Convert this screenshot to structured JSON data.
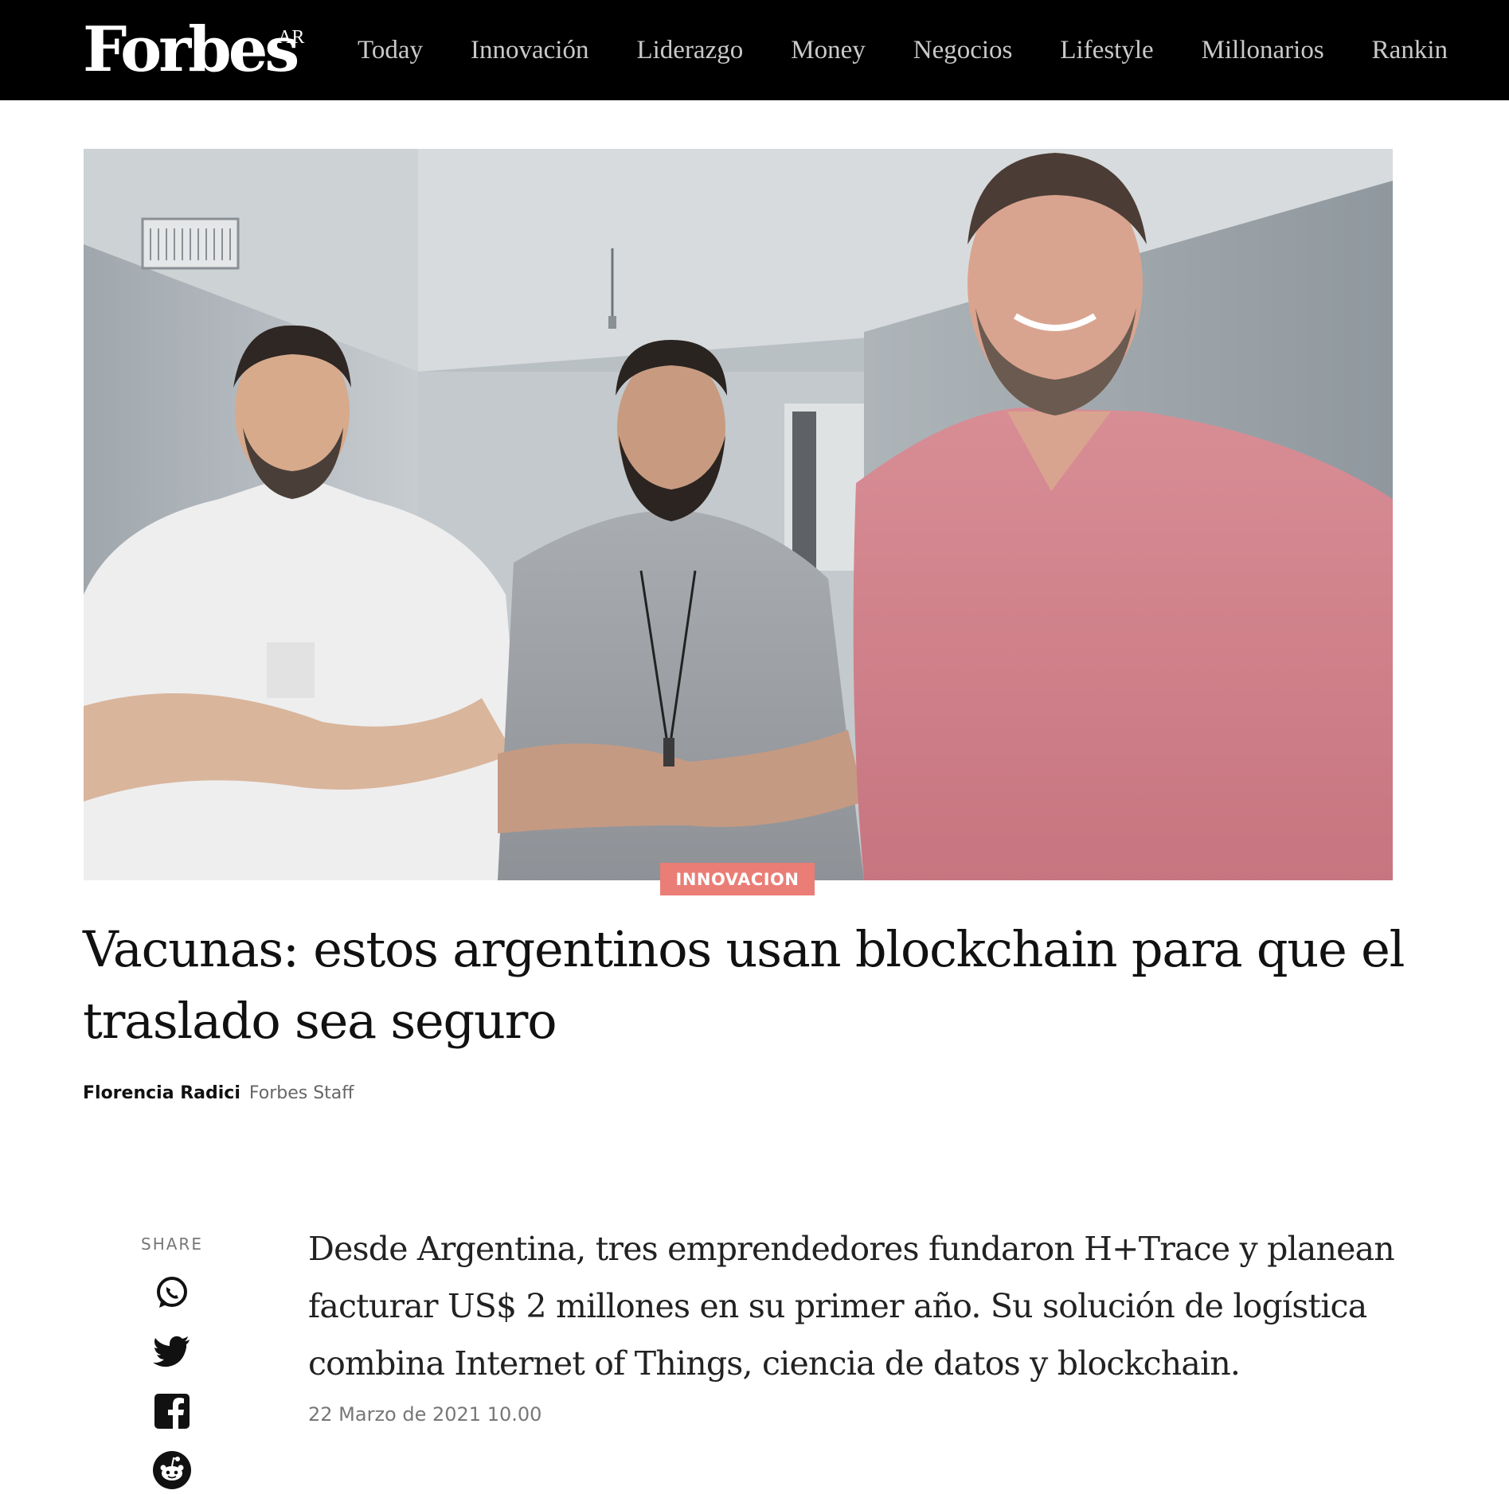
{
  "header": {
    "logo": "Forbes",
    "region": "AR",
    "nav": [
      "Today",
      "Innovación",
      "Liderazgo",
      "Money",
      "Negocios",
      "Lifestyle",
      "Millonarios",
      "Rankin"
    ]
  },
  "hero": {
    "image_icon": "photo-of-three-men-icon"
  },
  "article": {
    "category": "INNOVACION",
    "headline": "Vacunas: estos argentinos usan blockchain para que el traslado sea seguro",
    "author": "Florencia Radici",
    "author_role": "Forbes Staff",
    "summary": "Desde Argentina, tres emprendedores fundaron H+Trace y planean facturar US$ 2 millones en su primer año. Su solución de logística combina Internet of Things, ciencia de datos y blockchain.",
    "date": "22 Marzo de 2021 10.00"
  },
  "share": {
    "label": "SHARE",
    "buttons": [
      "whatsapp-icon",
      "twitter-icon",
      "facebook-icon",
      "reddit-icon"
    ]
  },
  "colors": {
    "topbar": "#000000",
    "category_badge": "#ea7d76",
    "nav_text": "#c9c9c9"
  }
}
